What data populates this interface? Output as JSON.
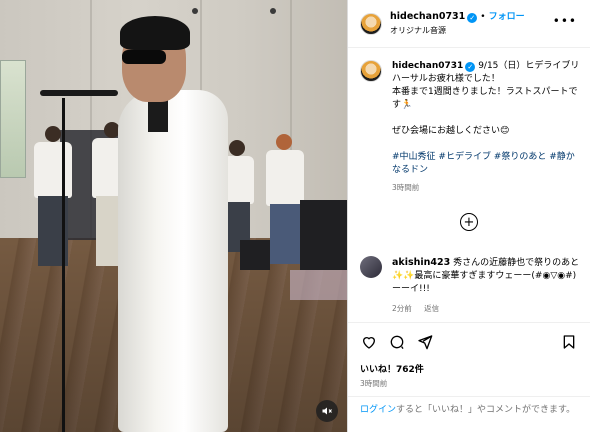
{
  "post": {
    "username": "hidechan0731",
    "follow_label": "フォロー",
    "separator": "•",
    "audio_label": "オリジナル音源",
    "more_icon": "more-icon"
  },
  "caption": {
    "username": "hidechan0731",
    "text": "9/15（日）ヒデライブリハーサルお疲れ様でした！\n本番まで1週間きりました！ラストスパートです🏃\n\nぜひ会場にお越しください😊",
    "hashtags": "#中山秀征 #ヒデライブ #祭りのあと #静かなるドン",
    "time": "3時間前"
  },
  "comment": {
    "username": "akishin423",
    "text": "秀さんの近藤静也で祭りのあと✨✨最高に豪華すぎますウェーー(#◉▽◉#)ーーイ!!!",
    "time": "2分前",
    "reply_label": "返信"
  },
  "actions": {
    "likes": "いいね！762件",
    "posted": "3時間前"
  },
  "login": {
    "link_label": "ログイン",
    "rest": "すると「いいね！」やコメントができます。"
  },
  "colors": {
    "accent": "#0095f6",
    "verified": "#0095f6",
    "hashtag": "#00376b",
    "muted": "#737373"
  }
}
